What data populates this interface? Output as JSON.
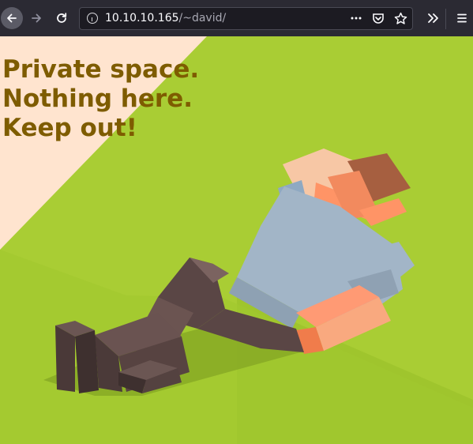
{
  "browser": {
    "url_host": "10.10.10.165",
    "url_path": "/~david/",
    "icons": {
      "back": "back-arrow-icon",
      "forward": "forward-arrow-icon",
      "reload": "reload-icon",
      "info": "info-icon",
      "page_actions": "more-dots-icon",
      "pocket": "pocket-icon",
      "bookmark": "star-icon",
      "overflow": "chevron-double-right-icon",
      "menu": "hamburger-menu-icon"
    }
  },
  "page": {
    "heading_line1": "Private space.",
    "heading_line2": "Nothing here.",
    "heading_line3": "Keep out!",
    "colors": {
      "heading": "#7e5c00",
      "grass": "#a9cd34",
      "sky": "#ffe4cf"
    }
  }
}
